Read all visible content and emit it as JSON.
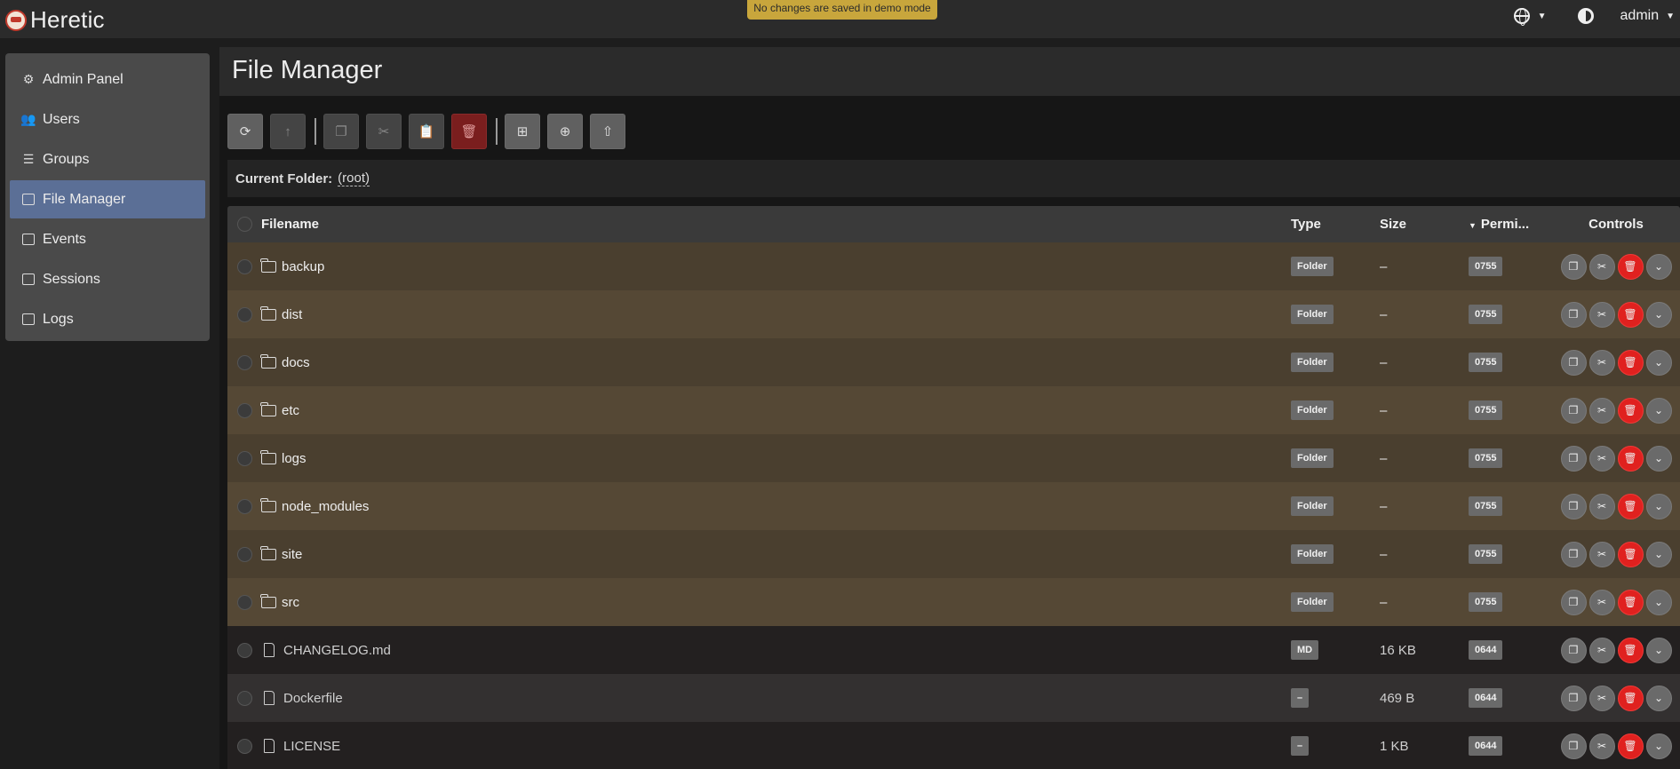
{
  "app": {
    "name": "Heretic"
  },
  "header": {
    "demo_notice": "No changes are saved in demo mode",
    "user": "admin"
  },
  "sidebar": {
    "items": [
      {
        "label": "Admin Panel",
        "icon": "gear-icon"
      },
      {
        "label": "Users",
        "icon": "users-icon"
      },
      {
        "label": "Groups",
        "icon": "groups-icon"
      },
      {
        "label": "File Manager",
        "icon": "folders-icon",
        "active": true
      },
      {
        "label": "Events",
        "icon": "calendar-icon"
      },
      {
        "label": "Sessions",
        "icon": "id-card-icon"
      },
      {
        "label": "Logs",
        "icon": "log-icon"
      }
    ]
  },
  "page": {
    "title": "File Manager"
  },
  "folder": {
    "label": "Current Folder:",
    "value": "(root)"
  },
  "table": {
    "headers": {
      "filename": "Filename",
      "type": "Type",
      "size": "Size",
      "permissions": "Permi...",
      "controls": "Controls"
    },
    "rows": [
      {
        "name": "backup",
        "kind": "folder",
        "type": "Folder",
        "size": "–",
        "perm": "0755"
      },
      {
        "name": "dist",
        "kind": "folder",
        "type": "Folder",
        "size": "–",
        "perm": "0755"
      },
      {
        "name": "docs",
        "kind": "folder",
        "type": "Folder",
        "size": "–",
        "perm": "0755"
      },
      {
        "name": "etc",
        "kind": "folder",
        "type": "Folder",
        "size": "–",
        "perm": "0755"
      },
      {
        "name": "logs",
        "kind": "folder",
        "type": "Folder",
        "size": "–",
        "perm": "0755"
      },
      {
        "name": "node_modules",
        "kind": "folder",
        "type": "Folder",
        "size": "–",
        "perm": "0755"
      },
      {
        "name": "site",
        "kind": "folder",
        "type": "Folder",
        "size": "–",
        "perm": "0755"
      },
      {
        "name": "src",
        "kind": "folder",
        "type": "Folder",
        "size": "–",
        "perm": "0755"
      },
      {
        "name": "CHANGELOG.md",
        "kind": "file",
        "type": "MD",
        "size": "16 KB",
        "perm": "0644"
      },
      {
        "name": "Dockerfile",
        "kind": "file",
        "type": "–",
        "size": "469 B",
        "perm": "0644"
      },
      {
        "name": "LICENSE",
        "kind": "file",
        "type": "–",
        "size": "1 KB",
        "perm": "0644"
      }
    ]
  }
}
